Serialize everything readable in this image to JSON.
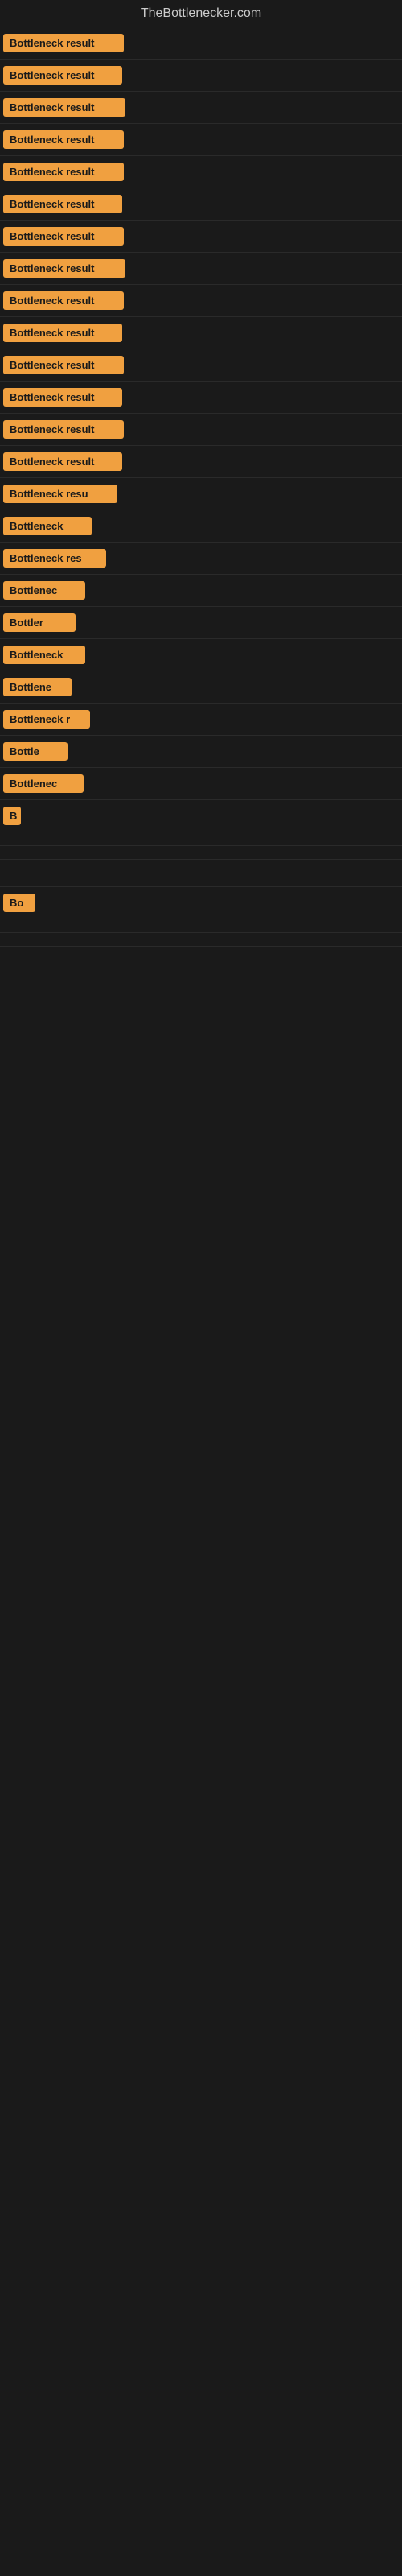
{
  "site": {
    "title": "TheBottlenecker.com"
  },
  "rows": [
    {
      "id": 1,
      "label": "Bottleneck result"
    },
    {
      "id": 2,
      "label": "Bottleneck result"
    },
    {
      "id": 3,
      "label": "Bottleneck result"
    },
    {
      "id": 4,
      "label": "Bottleneck result"
    },
    {
      "id": 5,
      "label": "Bottleneck result"
    },
    {
      "id": 6,
      "label": "Bottleneck result"
    },
    {
      "id": 7,
      "label": "Bottleneck result"
    },
    {
      "id": 8,
      "label": "Bottleneck result"
    },
    {
      "id": 9,
      "label": "Bottleneck result"
    },
    {
      "id": 10,
      "label": "Bottleneck result"
    },
    {
      "id": 11,
      "label": "Bottleneck result"
    },
    {
      "id": 12,
      "label": "Bottleneck result"
    },
    {
      "id": 13,
      "label": "Bottleneck result"
    },
    {
      "id": 14,
      "label": "Bottleneck result"
    },
    {
      "id": 15,
      "label": "Bottleneck resu"
    },
    {
      "id": 16,
      "label": "Bottleneck"
    },
    {
      "id": 17,
      "label": "Bottleneck res"
    },
    {
      "id": 18,
      "label": "Bottlenec"
    },
    {
      "id": 19,
      "label": "Bottler"
    },
    {
      "id": 20,
      "label": "Bottleneck"
    },
    {
      "id": 21,
      "label": "Bottlene"
    },
    {
      "id": 22,
      "label": "Bottleneck r"
    },
    {
      "id": 23,
      "label": "Bottle"
    },
    {
      "id": 24,
      "label": "Bottlenec"
    },
    {
      "id": 25,
      "label": "B"
    },
    {
      "id": 26,
      "label": ""
    },
    {
      "id": 27,
      "label": ""
    },
    {
      "id": 28,
      "label": ""
    },
    {
      "id": 29,
      "label": ""
    },
    {
      "id": 30,
      "label": "Bo"
    },
    {
      "id": 31,
      "label": ""
    },
    {
      "id": 32,
      "label": ""
    },
    {
      "id": 33,
      "label": ""
    }
  ]
}
